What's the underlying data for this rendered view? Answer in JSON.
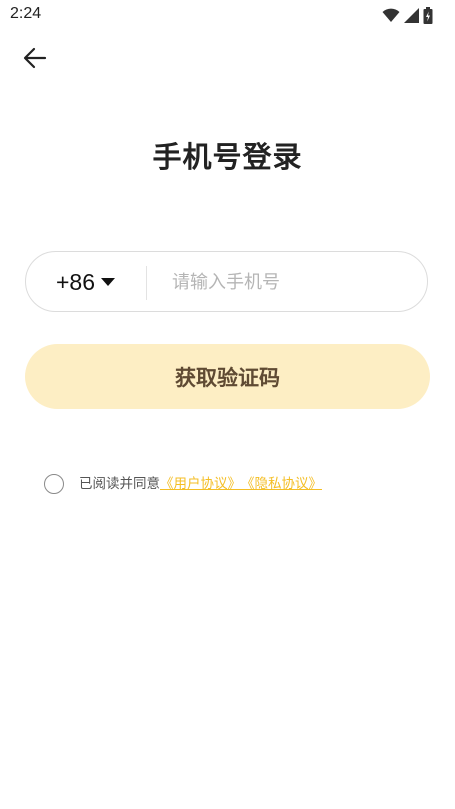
{
  "status_bar": {
    "time": "2:24",
    "icons": [
      "wifi-icon",
      "cell-signal-icon",
      "battery-icon"
    ]
  },
  "header": {
    "back_icon": "arrow-left-icon"
  },
  "title": "手机号登录",
  "phone": {
    "country_code": "+86",
    "dropdown_icon": "caret-down-icon",
    "placeholder": "请输入手机号",
    "value": ""
  },
  "get_code_button": "获取验证码",
  "agreement": {
    "checked": false,
    "prefix": "已阅读并同意",
    "user_agreement": "《用户协议》",
    "privacy_policy": "《隐私协议》"
  },
  "colors": {
    "button_bg": "#fdeec4",
    "button_text": "#5f4a33",
    "link": "#f4be24",
    "placeholder": "#b5b5b5"
  }
}
